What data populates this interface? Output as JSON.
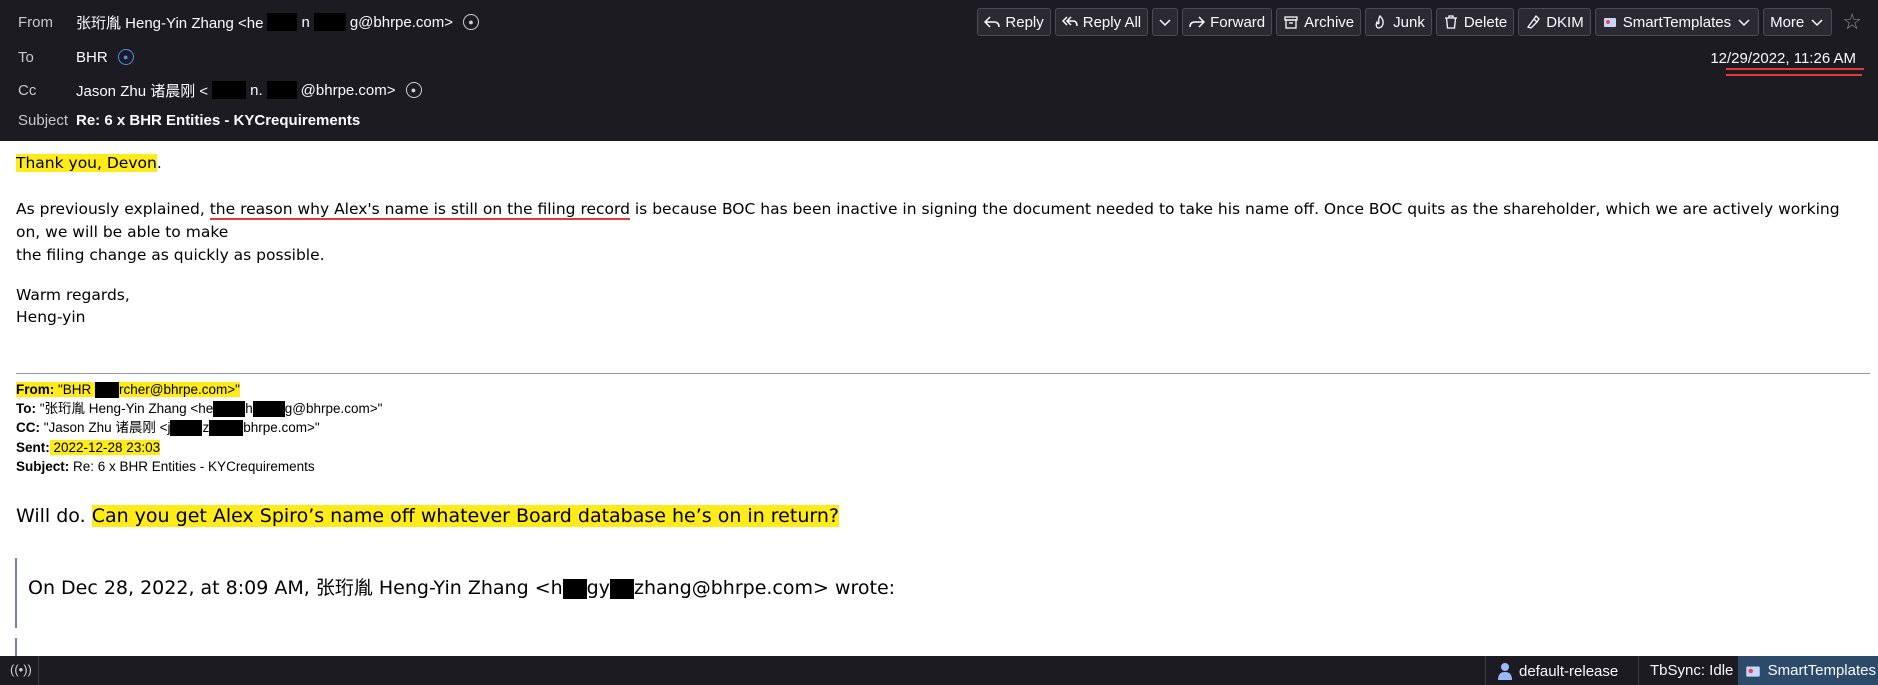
{
  "header": {
    "from_label": "From",
    "from_name": "张珩胤 Heng-Yin Zhang <he",
    "from_mid": "n",
    "from_tail": "g@bhrpe.com>",
    "to_label": "To",
    "to_value": "BHR",
    "cc_label": "Cc",
    "cc_name": "Jason Zhu 诸晨刚 <",
    "cc_mid": "n.",
    "cc_tail": "@bhrpe.com>",
    "subject_label": "Subject",
    "subject_value": "Re: 6 x BHR Entities - KYCrequirements",
    "date": "12/29/2022, 11:26 AM"
  },
  "toolbar": {
    "reply": "Reply",
    "reply_all": "Reply All",
    "forward": "Forward",
    "archive": "Archive",
    "junk": "Junk",
    "delete": "Delete",
    "dkim": "DKIM",
    "smart_templates": "SmartTemplates",
    "more": "More"
  },
  "body": {
    "greeting": "Thank you, Devon",
    "greeting_end": ".",
    "p1_start": "As previously explained, ",
    "p1_underlined": "the reason why Alex's name is still on the filing record",
    "p1_end": " is because BOC has been inactive in signing the document needed to take his name off. Once BOC quits as the shareholder, which we are actively working on, we will be able to make",
    "p1_line2": "the filing change as quickly as possible.",
    "closing": "Warm regards,",
    "signature": "Heng-yin"
  },
  "quoted": {
    "from_label": "From:",
    "from_start": " \"BHR ",
    "from_end": "rcher@bhrpe.com>\"",
    "to_label": "To:",
    "to_start": " \"张珩胤 Heng-Yin Zhang <he",
    "to_mid": "h",
    "to_end": "g@bhrpe.com>\"",
    "cc_label": "CC:",
    "cc_start": " \"Jason Zhu 诸晨刚 <j",
    "cc_mid": "z",
    "cc_end": "bhrpe.com>\"",
    "sent_label": "Sent:",
    "sent_value": " 2022-12-28 23:03",
    "subject_label": "Subject:",
    "subject_value": " Re: 6 x BHR Entities - KYCrequirements",
    "reply_start": "Will do. ",
    "reply_hl": "Can you get Alex Spiro’s name off whatever Board database he’s on in return?",
    "wrote_start": "On Dec 28, 2022, at 8:09 AM, 张珩胤 Heng-Yin Zhang <h",
    "wrote_mid": "gy",
    "wrote_end": "zhang@bhrpe.com> wrote:"
  },
  "status": {
    "release": "default-release",
    "tbsync": "TbSync: Idle",
    "smart_templates": "SmartTemplates"
  },
  "colors": {
    "header_bg": "#1c1b22",
    "highlight": "#ffeb18",
    "underline_red": "#e03a3a"
  }
}
